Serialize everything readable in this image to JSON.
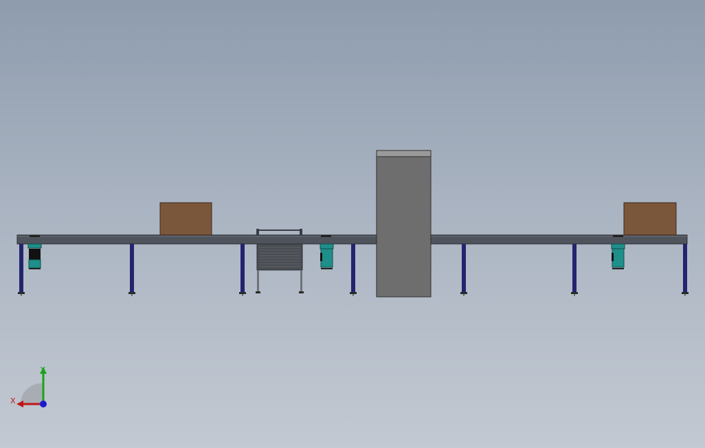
{
  "view": {
    "background_top": "#8e9cae",
    "background_bottom": "#c3c9d2"
  },
  "colors": {
    "conveyor_frame": "#4e535c",
    "conveyor_frame_edge": "#2b2e33",
    "leg": "#23246e",
    "leg_foot": "#2a2a2a",
    "box": "#7a563a",
    "box_edge": "#3d2a1c",
    "inspection_machine": "#6e6e6e",
    "inspection_machine_top": "#9a9a9a",
    "motor_teal": "#1f8f8a",
    "motor_dark": "#111111",
    "axis_x": "#c01616",
    "axis_y": "#1ba11b",
    "axis_z": "#1a1ad0"
  },
  "model": {
    "components": [
      "conveyor-frame",
      "carton-box",
      "carton-box",
      "inspection-machine",
      "lift-transfer-unit",
      "drive-motor",
      "drive-motor",
      "drive-motor"
    ]
  },
  "triad": {
    "x_label": "X",
    "y_label": "Y"
  }
}
